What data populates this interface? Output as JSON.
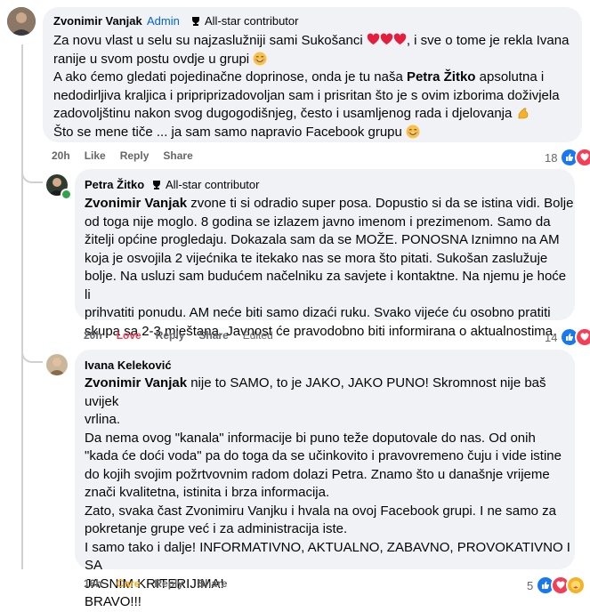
{
  "comments": [
    {
      "author": "Zvonimir Vanjak",
      "role": "Admin",
      "badge": "All-star contributor",
      "line1": "Za novu vlast u selu su najzaslužniji sami Sukošanci",
      "line1b": ", i sve o tome je rekla Ivana",
      "line2": "ranije u svom postu ovdje u grupi",
      "line3a": "A ako ćemo gledati pojedinačne doprinose, onda je tu naša ",
      "line3b": "Petra Žitko",
      "line3c": " apsolutna i",
      "line4": "nedodirljiva kraljica i pripriprizadovoljan sam i prisritan što je s ovim izborima doživjela",
      "line5": "zadovoljštinu nakon svog dugogodišnjeg, često i usamljenog rada i djelovanja",
      "line6": "Što se mene tiče ... ja sam samo napravio Facebook grupu",
      "time": "20h",
      "like": "Like",
      "reply": "Reply",
      "share": "Share",
      "reaction_count": "18"
    },
    {
      "author": "Petra Žitko",
      "badge": "All-star contributor",
      "mention": "Zvonimir Vanjak",
      "lines": [
        " zvone ti si odradio super posa. Dopustio si da se istina vidi. Bolje",
        "od toga nije moglo. 8 godina se izlazem javno imenom i prezimenom. Samo da",
        "žitelji općine progledaju. Dokazala sam da se MOŽE. PONOSNA Iznimno na AM",
        "koja je osvojila 2 vijećnika te itekako nas se mora što pitati. Sukošan zaslužuje",
        "bolje. Na usluzi sam budućem načelniku za savjete i kontaktne. Na njemu je hoće li",
        "prihvatiti ponudu. AM neće biti samo dizaći ruku. Svako vijeće ću osobno pratiti",
        "skupa sa 2-3 mještana. Javnost će pravodobno biti informirana o aktualnostima."
      ],
      "time": "20h",
      "love": "Love",
      "reply": "Reply",
      "share": "Share",
      "edited": "Edited",
      "reaction_count": "14"
    },
    {
      "author": "Ivana Keleković",
      "mention": "Zvonimir Vanjak",
      "lines": [
        " nije to SAMO, to je JAKO, JAKO PUNO! Skromnost nije baš uvijek",
        "vrlina.",
        "Da nema ovog \"kanala\" informacije bi puno teže doputovale do nas. Od onih",
        "\"kada će doći voda\" pa do toga da se učinkovito i pravovremeno čuju i vide istine",
        "do kojih svojim požrtvovnim radom dolazi Petra. Znamo što u današnje vrijeme",
        "znači kvalitetna, istinita i brza informacija.",
        "Zato, svaka čast Zvonimiru Vanjku i hvala na ovoj Facebook grupi. I ne samo za",
        "pokretanje grupe već i za administracija iste.",
        "I samo tako i dalje! INFORMATIVNO, AKTUALNO, ZABAVNO, PROVOKATIVNO I SA",
        "JASNIM KRITERIJIMA!",
        "BRAVO!!!"
      ],
      "time": "16h",
      "care": "Care",
      "reply": "Reply",
      "share": "Share",
      "reaction_count": "5"
    }
  ],
  "colors": {
    "like": "#1877f2",
    "love": "#f33e58",
    "care": "#f7b125",
    "admin": "#0064d1"
  }
}
